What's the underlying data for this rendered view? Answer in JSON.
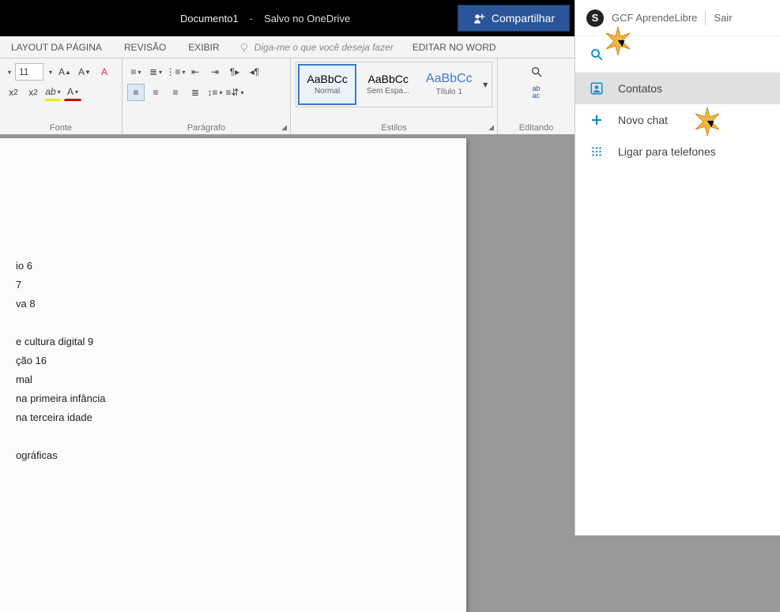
{
  "titlebar": {
    "doc": "Documento1",
    "separator": "-",
    "saved": "Salvo no OneDrive",
    "share": "Compartilhar"
  },
  "panel": {
    "brand": "GCF AprendeLibre",
    "signout": "Sair",
    "contacts": "Contatos",
    "newchat": "Novo chat",
    "callphones": "Ligar para telefones"
  },
  "ribbon_tabs": {
    "layout": "LAYOUT DA PÁGINA",
    "review": "REVISÃO",
    "view": "EXIBIR",
    "tellme": "Diga-me o que você deseja fazer",
    "editword": "EDITAR NO WORD"
  },
  "ribbon": {
    "font_size": "11",
    "font_label": "Fonte",
    "para_label": "Parágrafo",
    "styles_label": "Estilos",
    "editing_label": "Editando",
    "style1_sample": "AaBbCc",
    "style1_name": "Normal",
    "style2_sample": "AaBbCc",
    "style2_name": "Sem Espa...",
    "style3_sample": "AaBbCc",
    "style3_name": "Título 1"
  },
  "document": {
    "l1": "io 6",
    "l2": "7",
    "l3": "va 8",
    "l4": "e cultura digital 9",
    "l5": "ção 16",
    "l6": "mal",
    "l7": " na primeira infância",
    "l8": " na terceira idade",
    "l9": "ográficas"
  }
}
